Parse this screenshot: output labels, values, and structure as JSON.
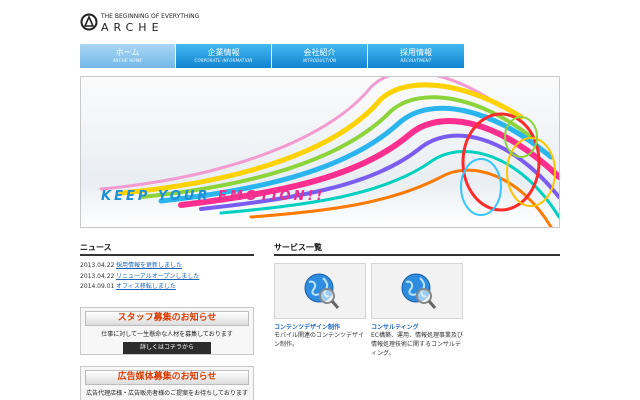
{
  "logo": {
    "tagline": "THE BEGINNING OF EVERYTHING",
    "name": "ARCHE"
  },
  "nav": [
    {
      "label": "ホーム",
      "sub": "ARCHE HOME"
    },
    {
      "label": "企業情報",
      "sub": "CORPORATE INFORMATION"
    },
    {
      "label": "会社紹介",
      "sub": "INTRODUCTION"
    },
    {
      "label": "採用情報",
      "sub": "RECRUITMENT"
    }
  ],
  "hero": {
    "text_part1": "KEEP YOUR ",
    "text_part2": "EMOTION!!"
  },
  "news": {
    "title": "ニュース",
    "items": [
      {
        "date": "2013.04.22",
        "text": "採用情報を更新しました"
      },
      {
        "date": "2013.04.22",
        "text": "リニューアルオープンしました"
      },
      {
        "date": "2014.09.01",
        "text": "オフィス移転しました"
      }
    ]
  },
  "banner_staff": {
    "title": "スタッフ募集のお知らせ",
    "text": "仕事に対して一生懸命な人材を募集しております",
    "button": "詳しくはコチラから"
  },
  "banner_ads": {
    "title": "広告媒体募集のお知らせ",
    "text": "広告代理店様・広告販売者様のご提案をお待ちしております"
  },
  "services": {
    "title": "サービス一覧",
    "items": [
      {
        "title": "コンテンツデザイン制作",
        "desc": "モバイル関連のコンテンツデザイン制作。"
      },
      {
        "title": "コンサルティング",
        "desc": "EC構築、運用、情報処理事業及び情報処理技術に関するコンサルティング。"
      }
    ]
  },
  "colors": {
    "nav_blue": "#1b95df",
    "link_blue": "#1d63b8",
    "accent_pink": "#e8308f",
    "accent_red": "#d93a00"
  }
}
